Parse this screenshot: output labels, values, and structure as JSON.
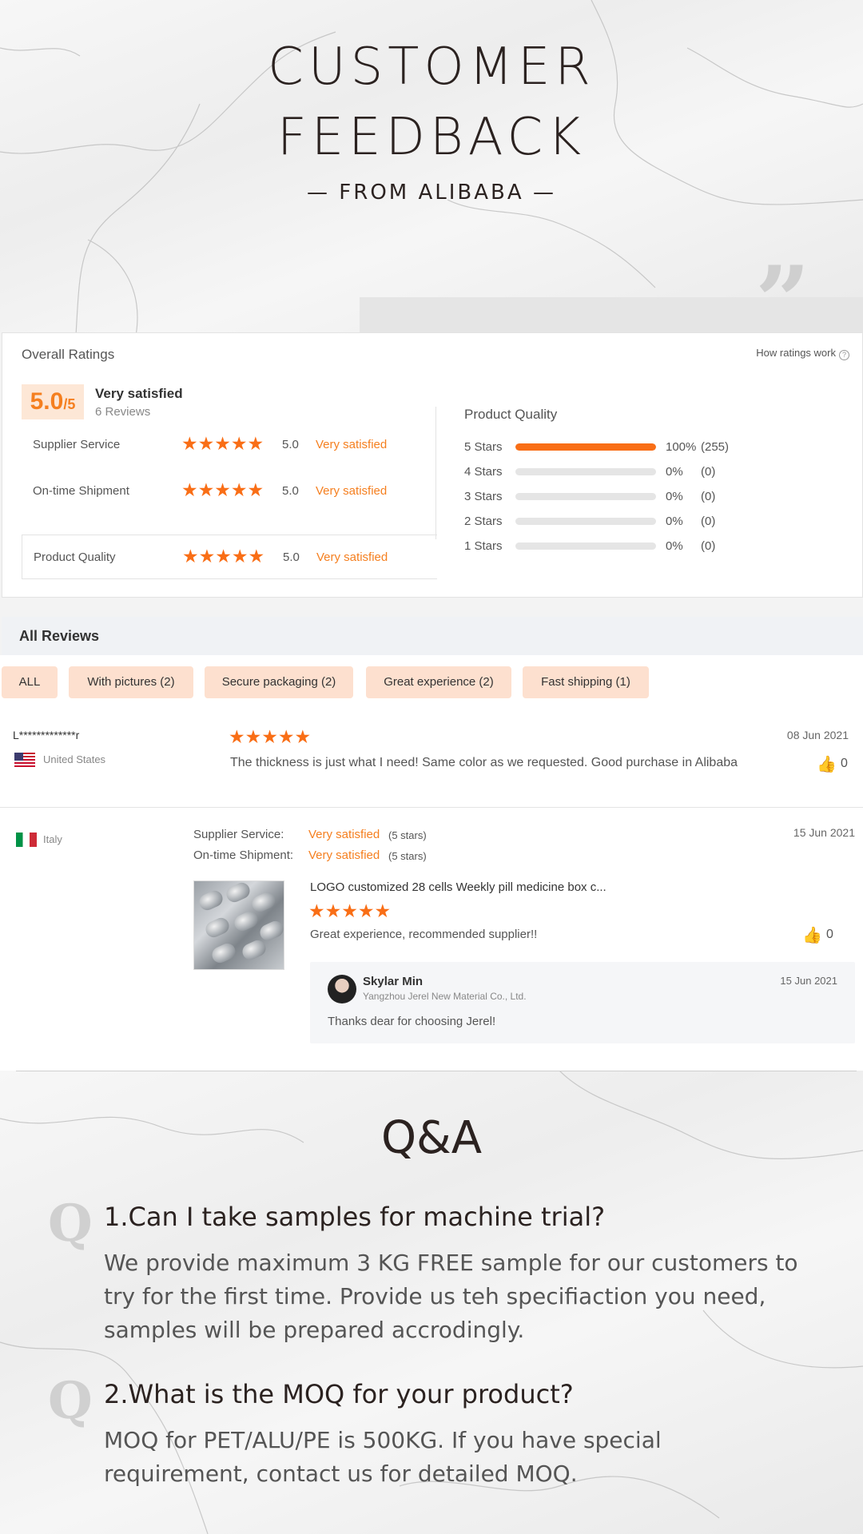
{
  "header": {
    "title_line1": "CUSTOMER",
    "title_line2": "FEEDBACK",
    "subtitle": "— FROM ALIBABA —",
    "quote_glyph": "”"
  },
  "ratings": {
    "title": "Overall Ratings",
    "how_link": "How ratings work",
    "help_glyph": "?",
    "score": "5.0",
    "score_max": "/5",
    "score_label": "Very satisfied",
    "review_count": "6 Reviews",
    "rows": [
      {
        "label": "Supplier Service",
        "stars": "★★★★★",
        "value": "5.0",
        "status": "Very satisfied"
      },
      {
        "label": "On-time Shipment",
        "stars": "★★★★★",
        "value": "5.0",
        "status": "Very satisfied"
      },
      {
        "label": "Product Quality",
        "stars": "★★★★★",
        "value": "5.0",
        "status": "Very satisfied"
      }
    ],
    "distribution_title": "Product Quality",
    "distribution": [
      {
        "label": "5  Stars",
        "fraction": 1.0,
        "percent": "100%",
        "count": "(255)"
      },
      {
        "label": "4  Stars",
        "fraction": 0,
        "percent": "0%",
        "count": "(0)"
      },
      {
        "label": "3  Stars",
        "fraction": 0,
        "percent": "0%",
        "count": "(0)"
      },
      {
        "label": "2  Stars",
        "fraction": 0,
        "percent": "0%",
        "count": "(0)"
      },
      {
        "label": "1  Stars",
        "fraction": 0,
        "percent": "0%",
        "count": "(0)"
      }
    ]
  },
  "reviews": {
    "header": "All Reviews",
    "filters": [
      "ALL",
      "With pictures (2)",
      "Secure packaging (2)",
      "Great experience (2)",
      "Fast shipping (1)"
    ],
    "items": [
      {
        "user": "L*************r",
        "country": "United States",
        "stars": "★★★★★",
        "text": "The thickness is just what I need! Same color as we requested. Good purchase in Alibaba",
        "date": "08 Jun 2021",
        "likes": "0"
      },
      {
        "country": "Italy",
        "supplier_label": "Supplier Service:",
        "supplier_value": "Very satisfied",
        "supplier_note": "(5 stars)",
        "shipment_label": "On-time Shipment:",
        "shipment_value": "Very satisfied",
        "shipment_note": "(5 stars)",
        "date": "15 Jun 2021",
        "product": "LOGO customized 28 cells Weekly pill medicine box c...",
        "stars": "★★★★★",
        "text": "Great experience, recommended supplier!!",
        "likes": "0",
        "reply": {
          "name": "Skylar Min",
          "company": "Yangzhou Jerel New Material Co., Ltd.",
          "date": "15 Jun 2021",
          "text": "Thanks dear for choosing Jerel!"
        }
      }
    ],
    "thumb_glyph": "👍"
  },
  "qa": {
    "title": "Q&A",
    "q_glyph": "Q",
    "items": [
      {
        "question": "1.Can I take samples for machine trial?",
        "answer": "We provide maximum 3 KG FREE sample for our customers to try for the first time. Provide us teh specifiaction you need, samples will be prepared accrodingly."
      },
      {
        "question": "2.What is the MOQ for your product?",
        "answer": "MOQ for PET/ALU/PE is 500KG. If you have special requirement, contact us for detailed MOQ."
      }
    ]
  },
  "colors": {
    "accent": "#f96e16",
    "accent_text": "#f57f1f",
    "chip_bg": "#fde0cf",
    "score_bg": "#fde7d6"
  }
}
